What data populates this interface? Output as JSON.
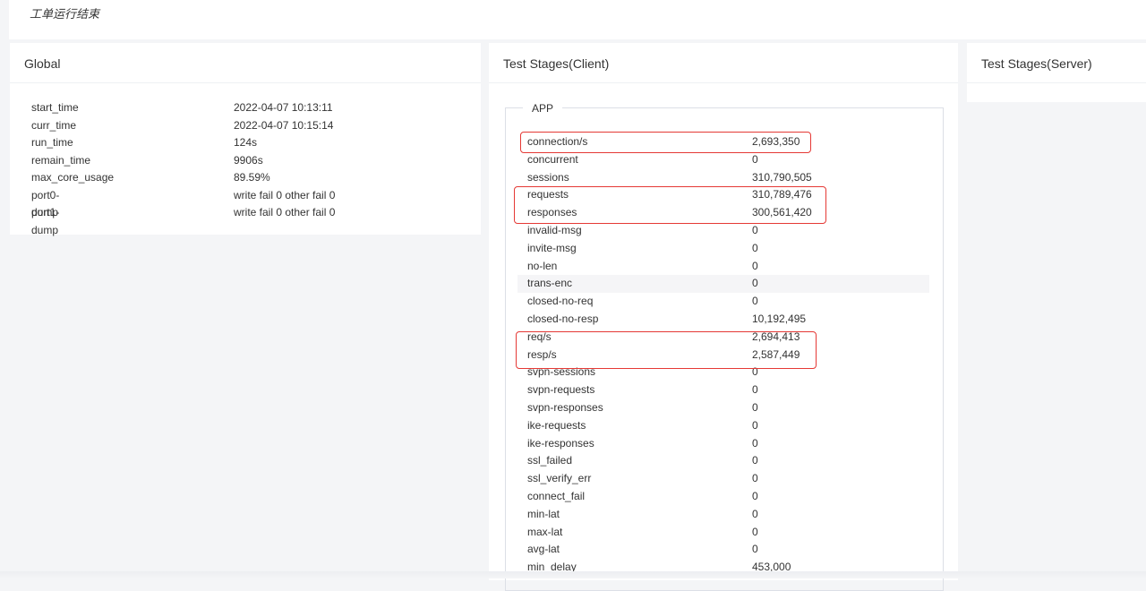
{
  "status": {
    "text": "工单运行结束"
  },
  "global": {
    "title": "Global",
    "rows": [
      {
        "key": "start_time",
        "value": "2022-04-07 10:13:11"
      },
      {
        "key": "curr_time",
        "value": "2022-04-07 10:15:14"
      },
      {
        "key": "run_time",
        "value": "124s"
      },
      {
        "key": "remain_time",
        "value": "9906s"
      },
      {
        "key": "max_core_usage",
        "value": "89.59%"
      },
      {
        "key": "port0-dump",
        "value": "write fail 0 other fail 0"
      },
      {
        "key": "port1-dump",
        "value": "write fail 0 other fail 0"
      }
    ]
  },
  "client": {
    "title": "Test Stages(Client)",
    "group_label": "APP",
    "rows": [
      {
        "key": "connection/s",
        "value": "2,693,350"
      },
      {
        "key": "concurrent",
        "value": "0"
      },
      {
        "key": "sessions",
        "value": "310,790,505"
      },
      {
        "key": "requests",
        "value": "310,789,476"
      },
      {
        "key": "responses",
        "value": "300,561,420"
      },
      {
        "key": "invalid-msg",
        "value": "0"
      },
      {
        "key": "invite-msg",
        "value": "0"
      },
      {
        "key": "no-len",
        "value": "0"
      },
      {
        "key": "trans-enc",
        "value": "0"
      },
      {
        "key": "closed-no-req",
        "value": "0"
      },
      {
        "key": "closed-no-resp",
        "value": "10,192,495"
      },
      {
        "key": "req/s",
        "value": "2,694,413"
      },
      {
        "key": "resp/s",
        "value": "2,587,449"
      },
      {
        "key": "svpn-sessions",
        "value": "0"
      },
      {
        "key": "svpn-requests",
        "value": "0"
      },
      {
        "key": "svpn-responses",
        "value": "0"
      },
      {
        "key": "ike-requests",
        "value": "0"
      },
      {
        "key": "ike-responses",
        "value": "0"
      },
      {
        "key": "ssl_failed",
        "value": "0"
      },
      {
        "key": "ssl_verify_err",
        "value": "0"
      },
      {
        "key": "connect_fail",
        "value": "0"
      },
      {
        "key": "min-lat",
        "value": "0"
      },
      {
        "key": "max-lat",
        "value": "0"
      },
      {
        "key": "avg-lat",
        "value": "0"
      },
      {
        "key": "min_delay",
        "value": "453,000"
      }
    ]
  },
  "server": {
    "title": "Test Stages(Server)"
  },
  "colors": {
    "highlight": "#e53935",
    "row_shade": "#f5f5f7"
  }
}
